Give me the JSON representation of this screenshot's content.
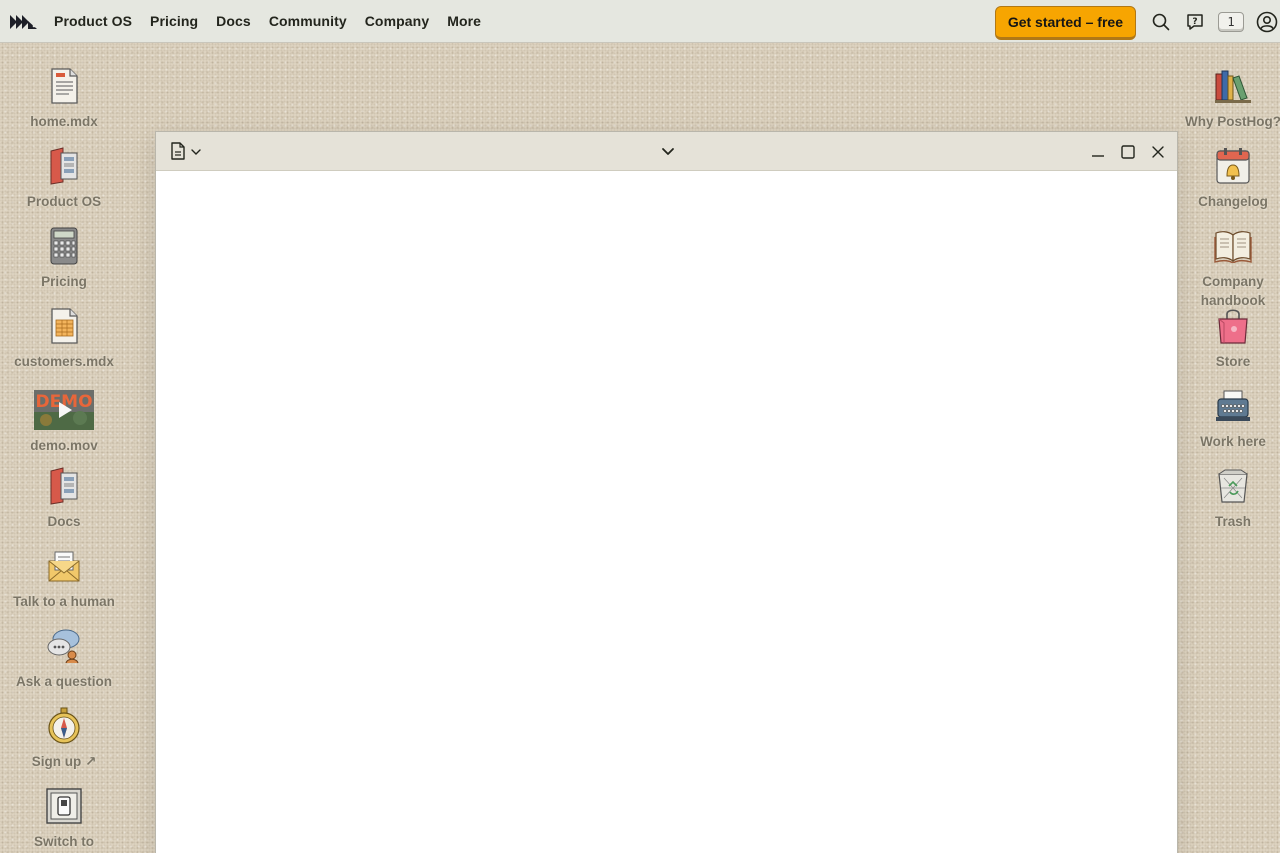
{
  "nav": {
    "logo": "posthog-hedgehog-logo",
    "items": [
      "Product OS",
      "Pricing",
      "Docs",
      "Community",
      "Company",
      "More"
    ],
    "cta_label": "Get started – free",
    "badge_count": "1",
    "accent_color": "#f7a501"
  },
  "desktop_left": [
    {
      "label": "home.mdx",
      "icon": "document-icon"
    },
    {
      "label": "Product OS",
      "icon": "product-os-icon"
    },
    {
      "label": "Pricing",
      "icon": "calculator-icon"
    },
    {
      "label": "customers.mdx",
      "icon": "spreadsheet-icon"
    },
    {
      "label": "demo.mov",
      "icon": "video-icon",
      "overlay": "DEMO"
    },
    {
      "label": "Docs",
      "icon": "docs-icon"
    },
    {
      "label": "Talk to a human",
      "icon": "envelope-icon"
    },
    {
      "label": "Ask a question",
      "icon": "chat-bubbles-icon"
    },
    {
      "label": "Sign up ↗",
      "icon": "compass-icon"
    },
    {
      "label": "Switch to",
      "icon": "switch-icon"
    }
  ],
  "desktop_right": [
    {
      "label": "Why PostHog?",
      "icon": "books-icon"
    },
    {
      "label": "Changelog",
      "icon": "calendar-bell-icon"
    },
    {
      "label": "Company\nhandbook",
      "icon": "open-book-icon"
    },
    {
      "label": "Store",
      "icon": "shopping-bag-icon"
    },
    {
      "label": "Work here",
      "icon": "typewriter-icon"
    },
    {
      "label": "Trash",
      "icon": "trash-icon"
    }
  ]
}
